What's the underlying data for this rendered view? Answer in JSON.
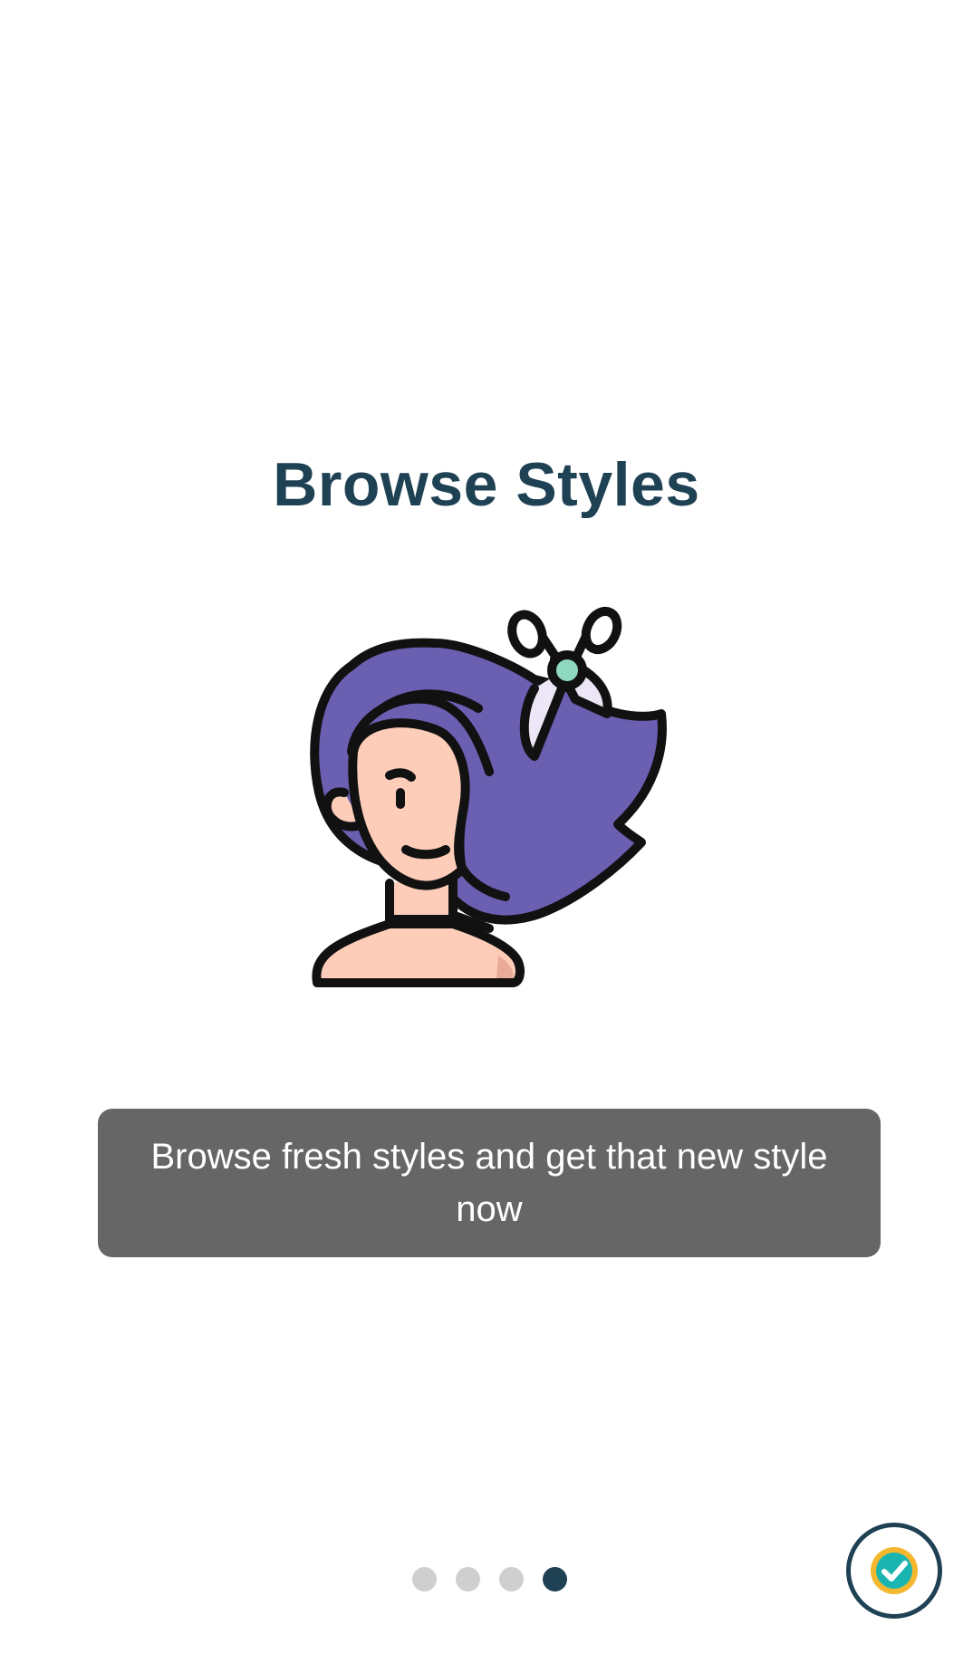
{
  "onboarding": {
    "title": "Browse Styles",
    "description": "Browse fresh styles and get that new style now",
    "illustration_icon": "hair-salon-scissors-icon",
    "pager": {
      "total_pages": 4,
      "current_page": 4
    },
    "done_button_icon": "check-badge-icon"
  },
  "colors": {
    "title": "#1f4154",
    "caption_background": "#666666",
    "dot_inactive": "#cfcfcf",
    "dot_active": "#1f4154",
    "hair": "#6a5fb0",
    "skin": "#fdcdb9",
    "badge_gold": "#f5b72e",
    "badge_teal": "#1bb5b1"
  }
}
